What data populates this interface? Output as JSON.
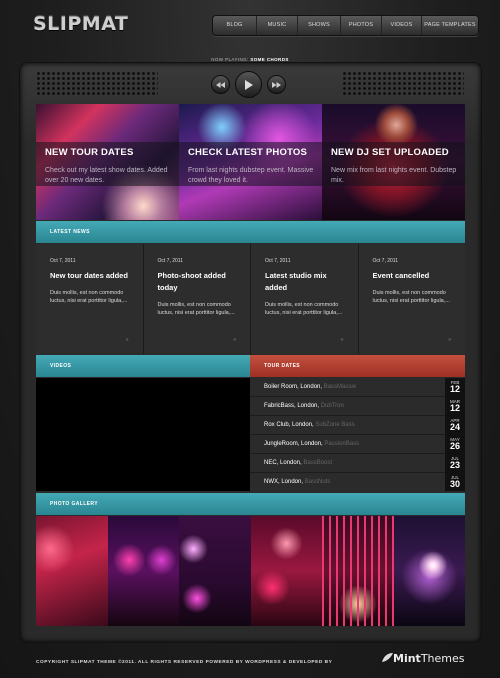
{
  "header": {
    "logo": "SLIPMAT",
    "nav": [
      "BLOG",
      "MUSIC",
      "SHOWS",
      "PHOTOS",
      "VIDEOS",
      "PAGE TEMPLATES"
    ]
  },
  "player": {
    "now_playing_prefix": "NOW PLAYING:",
    "now_playing_track": "SOME CHORDS",
    "controls": [
      "rewind-icon",
      "play-icon",
      "fast-forward-icon"
    ]
  },
  "features": [
    {
      "title": "NEW TOUR DATES",
      "text": "Check out my latest show dates. Added over 20 new dates."
    },
    {
      "title": "CHECK LATEST PHOTOS",
      "text": "From last nights dubstep event. Massive crowd they loved it."
    },
    {
      "title": "NEW DJ SET UPLOADED",
      "text": "New mix from last nights event. Dubstep mix."
    }
  ],
  "news": {
    "heading": "LATEST NEWS",
    "items": [
      {
        "date": "Oct 7, 2011",
        "title": "New tour dates added",
        "body": "Duis mollis, est non commodo luctus, nisi erat porttitor ligula,...",
        "more": "»"
      },
      {
        "date": "Oct 7, 2011",
        "title": "Photo-shoot added today",
        "body": "Duis mollis, est non commodo luctus, nisi erat porttitor ligula,...",
        "more": "»"
      },
      {
        "date": "Oct 7, 2011",
        "title": "Latest studio mix added",
        "body": "Duis mollis, est non commodo luctus, nisi erat porttitor ligula,...",
        "more": "»"
      },
      {
        "date": "Oct 7, 2011",
        "title": "Event cancelled",
        "body": "Duis mollis, est non commodo luctus, nisi erat porttitor ligula,...",
        "more": "»"
      }
    ]
  },
  "videos": {
    "heading": "VIDEOS"
  },
  "tours": {
    "heading": "TOUR DATES",
    "items": [
      {
        "venue": "Boiler Room, London,",
        "act": "BassMassie",
        "month": "FEB",
        "day": "12"
      },
      {
        "venue": "FabricBass, London,",
        "act": "DubTron",
        "month": "MAR",
        "day": "12"
      },
      {
        "venue": "Rox Club, London,",
        "act": "SubZone Bass",
        "month": "APR",
        "day": "24"
      },
      {
        "venue": "JungleRoom, London,",
        "act": "PassionBass",
        "month": "MAY",
        "day": "26"
      },
      {
        "venue": "NEC, London,",
        "act": "BassBoost",
        "month": "JUL",
        "day": "23"
      },
      {
        "venue": "NWX, London,",
        "act": "BassNuts",
        "month": "JUL",
        "day": "30"
      }
    ]
  },
  "gallery": {
    "heading": "PHOTO GALLERY"
  },
  "footer": {
    "text": "COPYRIGHT SLIPMAT THEME ©2011. ALL RIGHTS RESERVED  POWERED BY WORDPRESS & DEVELOPED BY",
    "brand_a": "Mint",
    "brand_b": "Themes"
  },
  "colors": {
    "teal": "#3a9aa6",
    "red": "#b3402f",
    "background": "#1c1c1c"
  }
}
